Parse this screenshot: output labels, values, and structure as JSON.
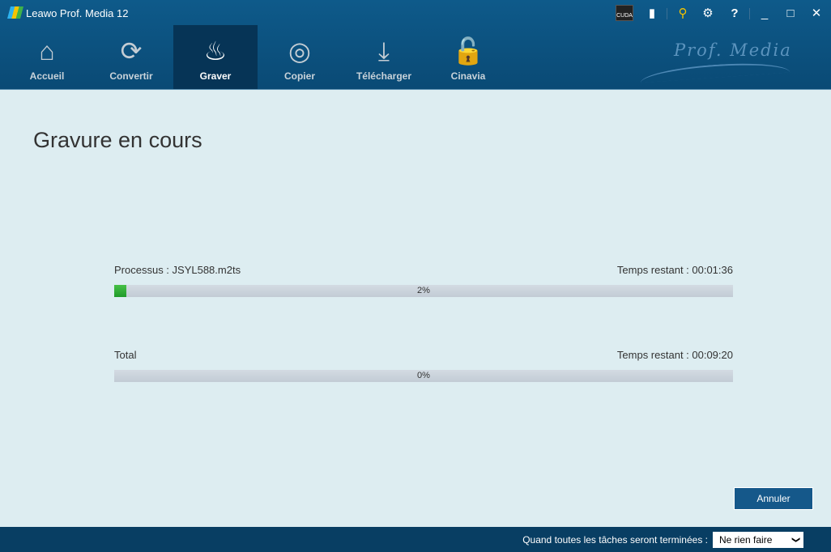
{
  "window": {
    "title": "Leawo Prof. Media 12",
    "brand": "Prof. Media",
    "cuda": "CUDA"
  },
  "nav": [
    {
      "label": "Accueil",
      "icon": "home-icon"
    },
    {
      "label": "Convertir",
      "icon": "convert-icon"
    },
    {
      "label": "Graver",
      "icon": "burn-flame-icon",
      "active": true
    },
    {
      "label": "Copier",
      "icon": "copy-disc-icon"
    },
    {
      "label": "Télécharger",
      "icon": "download-icon"
    },
    {
      "label": "Cinavia",
      "icon": "unlock-icon"
    }
  ],
  "main": {
    "title": "Gravure en cours",
    "process": {
      "label": "Processus :  JSYL588.m2ts",
      "remaining": "Temps restant :  00:01:36",
      "percent": 2,
      "percent_label": "2%"
    },
    "total": {
      "label": "Total",
      "remaining": "Temps restant :  00:09:20",
      "percent": 0,
      "percent_label": "0%"
    },
    "cancel_label": "Annuler"
  },
  "footer": {
    "label": "Quand toutes les tâches seront terminées :",
    "select_value": "Ne rien faire"
  },
  "colors": {
    "accent": "#15588a",
    "progress": "#2ea836"
  }
}
